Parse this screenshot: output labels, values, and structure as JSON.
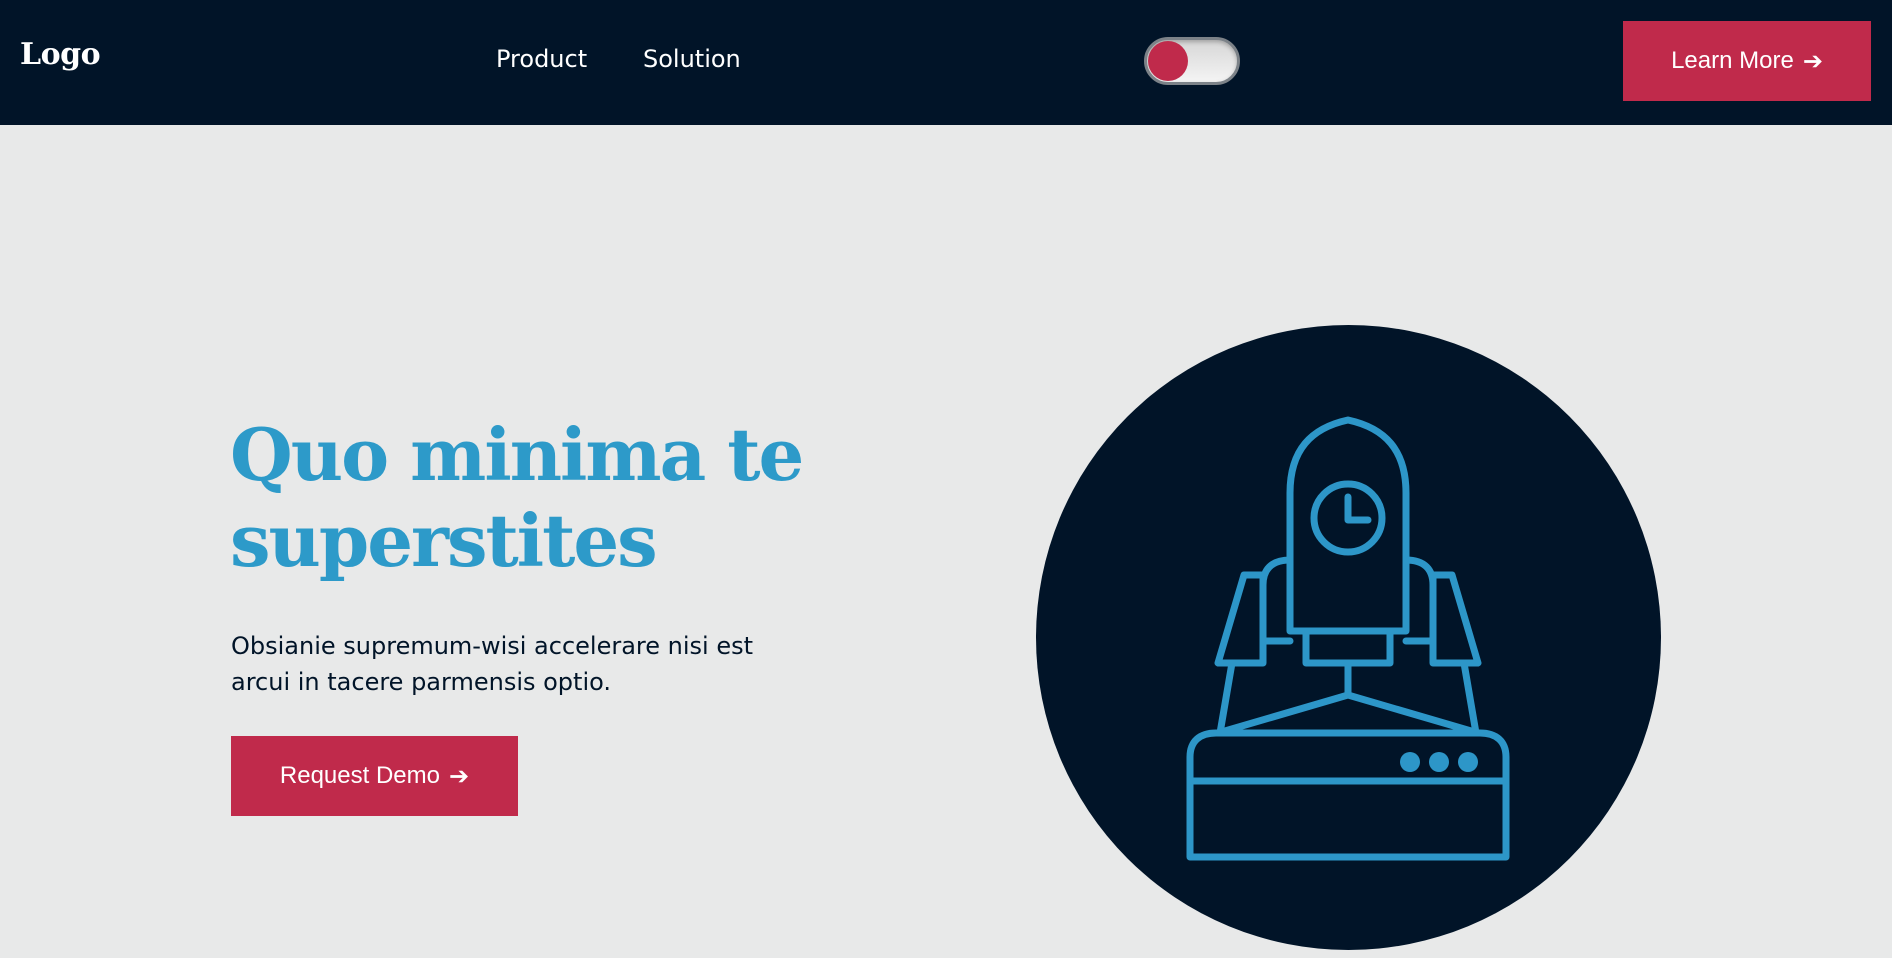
{
  "header": {
    "logo": "Logo",
    "nav": [
      {
        "label": "Product"
      },
      {
        "label": "Solution"
      }
    ],
    "cta_label": "Learn More",
    "cta_arrow": "➔"
  },
  "hero": {
    "title": "Quo minima te superstites",
    "description": "Obsianie supremum-wisi accelerare nisi est arcui in tacere parmensis optio.",
    "cta_label": "Request Demo",
    "cta_arrow": "➔",
    "illustration_icon": "rocket-launch-icon"
  },
  "colors": {
    "navy": "#011428",
    "accent": "#c02a4b",
    "headline": "#2d9ac9",
    "background": "#e8e9e9",
    "icon_stroke": "#2d96c8"
  }
}
